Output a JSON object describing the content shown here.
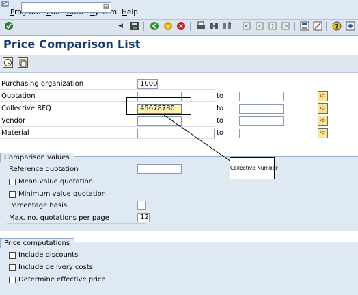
{
  "menu": {
    "items": [
      "Program",
      "Edit",
      "Goto",
      "System",
      "Help"
    ],
    "underline": [
      "P",
      "E",
      "G",
      "S",
      "H"
    ],
    "rest": [
      "rogram",
      "dit",
      "oto",
      "ystem",
      "elp"
    ]
  },
  "icons": {
    "toolbar": [
      "enter-icon",
      "back-icon",
      "exit-icon",
      "cancel-icon",
      "print-icon",
      "find-icon",
      "find-next-icon",
      "first-page-icon",
      "previous-page-icon",
      "next-page-icon",
      "last-page-icon",
      "create-session-icon",
      "shortcut-icon",
      "help-icon",
      "layout-icon"
    ],
    "app_toolbar": [
      "execute-icon",
      "get-variant-icon"
    ]
  },
  "title": "Price Comparison List",
  "selection": {
    "purchasing_org": {
      "label": "Purchasing organization",
      "value": "1000"
    },
    "quotation": {
      "label": "Quotation",
      "to": "to",
      "from_value": "",
      "to_value": ""
    },
    "collective_rfq": {
      "label": "Collective RFQ",
      "to": "to",
      "from_value": "45678780",
      "to_value": ""
    },
    "vendor": {
      "label": "Vendor",
      "to": "to",
      "from_value": "",
      "to_value": ""
    },
    "material": {
      "label": "Material",
      "to": "to",
      "from_value": "",
      "to_value": ""
    }
  },
  "comparison_values": {
    "title": "Comparison values",
    "reference_quotation": {
      "label": "Reference quotation",
      "value": ""
    },
    "mean_value_quotation": {
      "label": "Mean value quotation",
      "checked": false
    },
    "minimum_value_quotation": {
      "label": "Minimum value quotation",
      "checked": false
    },
    "percentage_basis": {
      "label": "Percentage basis",
      "value": ""
    },
    "max_quotations": {
      "label": "Max. no. quotations per page",
      "value": "12"
    }
  },
  "price_computations": {
    "title": "Price computations",
    "include_discounts": {
      "label": "Include discounts",
      "checked": false
    },
    "include_delivery_costs": {
      "label": "Include delivery costs",
      "checked": false
    },
    "determine_effective_price": {
      "label": "Determine effective price",
      "checked": false
    }
  },
  "annotation": {
    "text": "Collective Number"
  },
  "colors": {
    "title": "#173a6b",
    "highlight_field": "#fef3b4",
    "group_bg": "#dfe9f3",
    "arrow": "#b35a00"
  }
}
